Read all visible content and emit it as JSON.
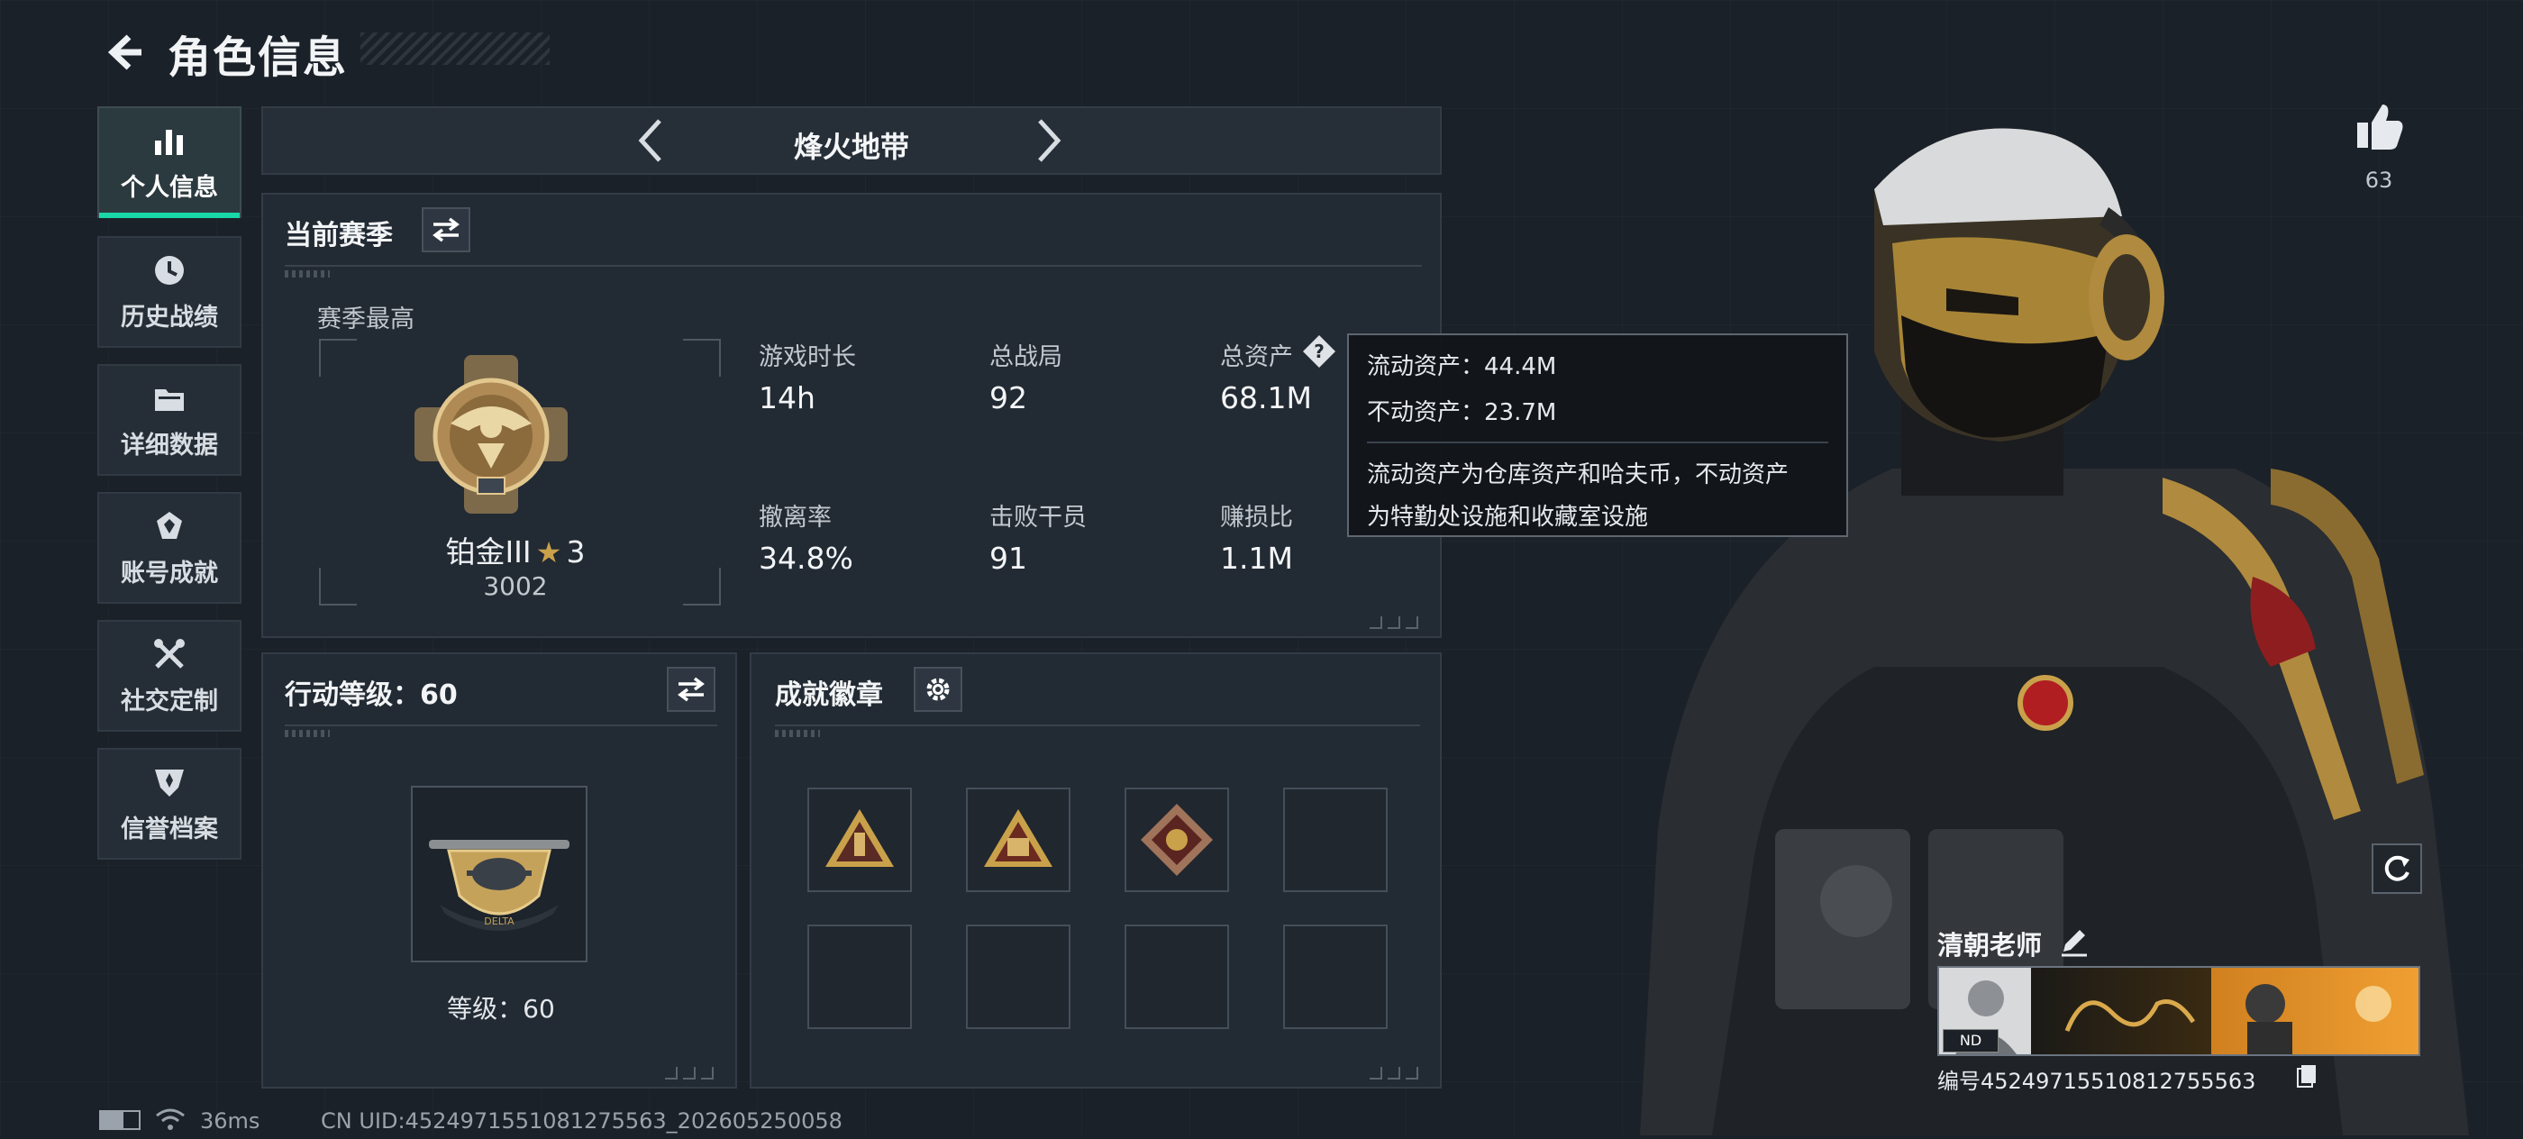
{
  "header": {
    "title": "角色信息"
  },
  "nav": {
    "items": [
      {
        "label": "个人信息",
        "icon": "bar-chart-icon",
        "active": true
      },
      {
        "label": "历史战绩",
        "icon": "clock-icon",
        "active": false
      },
      {
        "label": "详细数据",
        "icon": "folder-icon",
        "active": false
      },
      {
        "label": "账号成就",
        "icon": "achievement-icon",
        "active": false
      },
      {
        "label": "社交定制",
        "icon": "tools-icon",
        "active": false
      },
      {
        "label": "信誉档案",
        "icon": "shield-icon",
        "active": false
      }
    ]
  },
  "mode": {
    "name": "烽火地带"
  },
  "season": {
    "title": "当前赛季",
    "best_label": "赛季最高",
    "rank_name": "铂金III",
    "rank_stars": "3",
    "rank_points": "3002",
    "stats": [
      {
        "label": "游戏时长",
        "value": "14h"
      },
      {
        "label": "总战局",
        "value": "92"
      },
      {
        "label": "总资产",
        "value": "68.1M"
      },
      {
        "label": "撤离率",
        "value": "34.8%"
      },
      {
        "label": "击败干员",
        "value": "91"
      },
      {
        "label": "赚损比",
        "value": "1.1M"
      }
    ]
  },
  "tooltip": {
    "line1": "流动资产：44.4M",
    "line2": "不动资产：23.7M",
    "desc1": "流动资产为仓库资产和哈夫币，不动资产",
    "desc2": "为特勤处设施和收藏室设施"
  },
  "action_level": {
    "title": "行动等级：60",
    "level_text": "等级：60"
  },
  "achievements": {
    "title": "成就徽章"
  },
  "likes": {
    "count": "63"
  },
  "player": {
    "name": "清朝老师",
    "id_text": "编号4524971551081275556​3",
    "card_tag": "ND"
  },
  "status": {
    "ping": "36ms",
    "uid": "CN UID:4524971551081275563_202605250058"
  },
  "colors": {
    "accent": "#19d7a9",
    "gold": "#c9a14a",
    "panel": "#222a33"
  }
}
